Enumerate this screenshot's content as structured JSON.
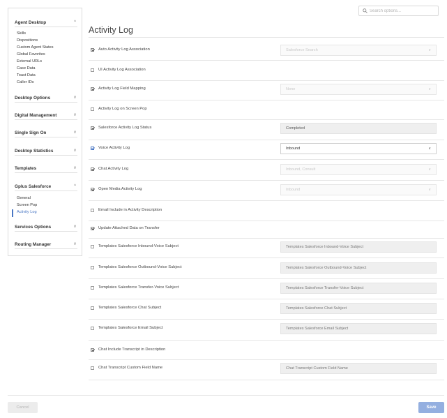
{
  "search": {
    "placeholder": "Search options..."
  },
  "sidebar": {
    "sections": [
      {
        "label": "Agent Desktop",
        "chevron": "^",
        "expanded": true,
        "items": [
          "Skills",
          "Dispositions",
          "Custom Agent States",
          "Global Favorites",
          "External URLs",
          "Case Data",
          "Toast Data",
          "Caller IDs"
        ]
      },
      {
        "label": "Desktop Options",
        "chevron": "v"
      },
      {
        "label": "Digital Management",
        "chevron": "v"
      },
      {
        "label": "Single Sign On",
        "chevron": "v"
      },
      {
        "label": "Desktop Statistics",
        "chevron": "v"
      },
      {
        "label": "Templates",
        "chevron": "v"
      },
      {
        "label": "Gplus Salesforce",
        "chevron": "^",
        "expanded": true,
        "items": [
          "General",
          "Screen Pop",
          "Activity Log"
        ],
        "active_item": "Activity Log"
      },
      {
        "label": "Services Options",
        "chevron": "v"
      },
      {
        "label": "Routing Manager",
        "chevron": "v"
      }
    ]
  },
  "main": {
    "title": "Activity Log",
    "settings": [
      {
        "label": "Auto Activity Log Association",
        "checked": true,
        "control": {
          "kind": "select",
          "state": "disabled",
          "value": "Salesforce Search"
        }
      },
      {
        "label": "UI Activity Log Association",
        "checked": false,
        "control": null
      },
      {
        "label": "Activity Log Field Mapping",
        "checked": true,
        "control": {
          "kind": "select",
          "state": "disabled",
          "value": "None"
        }
      },
      {
        "label": "Activity Log on Screen Pop",
        "checked": false,
        "control": null
      },
      {
        "label": "Salesforce Activity Log Status",
        "checked": true,
        "control": {
          "kind": "field",
          "value": "Completed"
        }
      },
      {
        "label": "Voice Activity Log",
        "checked": true,
        "checkbox_color": "#4a77c4",
        "control": {
          "kind": "select",
          "state": "active",
          "value": "Inbound"
        }
      },
      {
        "label": "Chat Activity Log",
        "checked": true,
        "control": {
          "kind": "select",
          "state": "disabled",
          "value": "Inbound, Consult"
        }
      },
      {
        "label": "Open Media Activity Log",
        "checked": true,
        "control": {
          "kind": "select",
          "state": "disabled",
          "value": "Inbound"
        }
      },
      {
        "label": "Email Include in Activity Description",
        "checked": false,
        "control": null
      },
      {
        "label": "Update Attached Data on Transfer",
        "checked": true,
        "control": null
      },
      {
        "label": "Templates Salesforce Inbound-Voice Subject",
        "checked": false,
        "control": {
          "kind": "input",
          "placeholder": "Templates Salesforce Inbound-Voice Subject"
        }
      },
      {
        "label": "Templates Salesforce Outbound-Voice Subject",
        "checked": false,
        "control": {
          "kind": "input",
          "placeholder": "Templates Salesforce Outbound-Voice Subject"
        }
      },
      {
        "label": "Templates Salesforce Transfer-Voice Subject",
        "checked": false,
        "control": {
          "kind": "input",
          "placeholder": "Templates Salesforce Transfer-Voice Subject"
        }
      },
      {
        "label": "Templates Salesforce Chat Subject",
        "checked": false,
        "control": {
          "kind": "input",
          "placeholder": "Templates Salesforce Chat Subject"
        }
      },
      {
        "label": "Templates Salesforce Email Subject",
        "checked": false,
        "control": {
          "kind": "input",
          "placeholder": "Templates Salesforce Email Subject"
        }
      },
      {
        "label": "Chat Include Transcript in Description",
        "checked": true,
        "control": null
      },
      {
        "label": "Chat Transcript Custom Field Name",
        "checked": false,
        "control": {
          "kind": "input",
          "placeholder": "Chat Transcript Custom Field Name"
        }
      }
    ]
  },
  "footer": {
    "cancel_label": "Cancel",
    "save_label": "Save"
  },
  "colors": {
    "accent": "#4a77c4",
    "save_button": "#94afe0",
    "cancel_button": "#ececec"
  },
  "icons": [
    "search-icon",
    "chevron-up-icon",
    "chevron-down-icon",
    "checkmark-icon"
  ]
}
